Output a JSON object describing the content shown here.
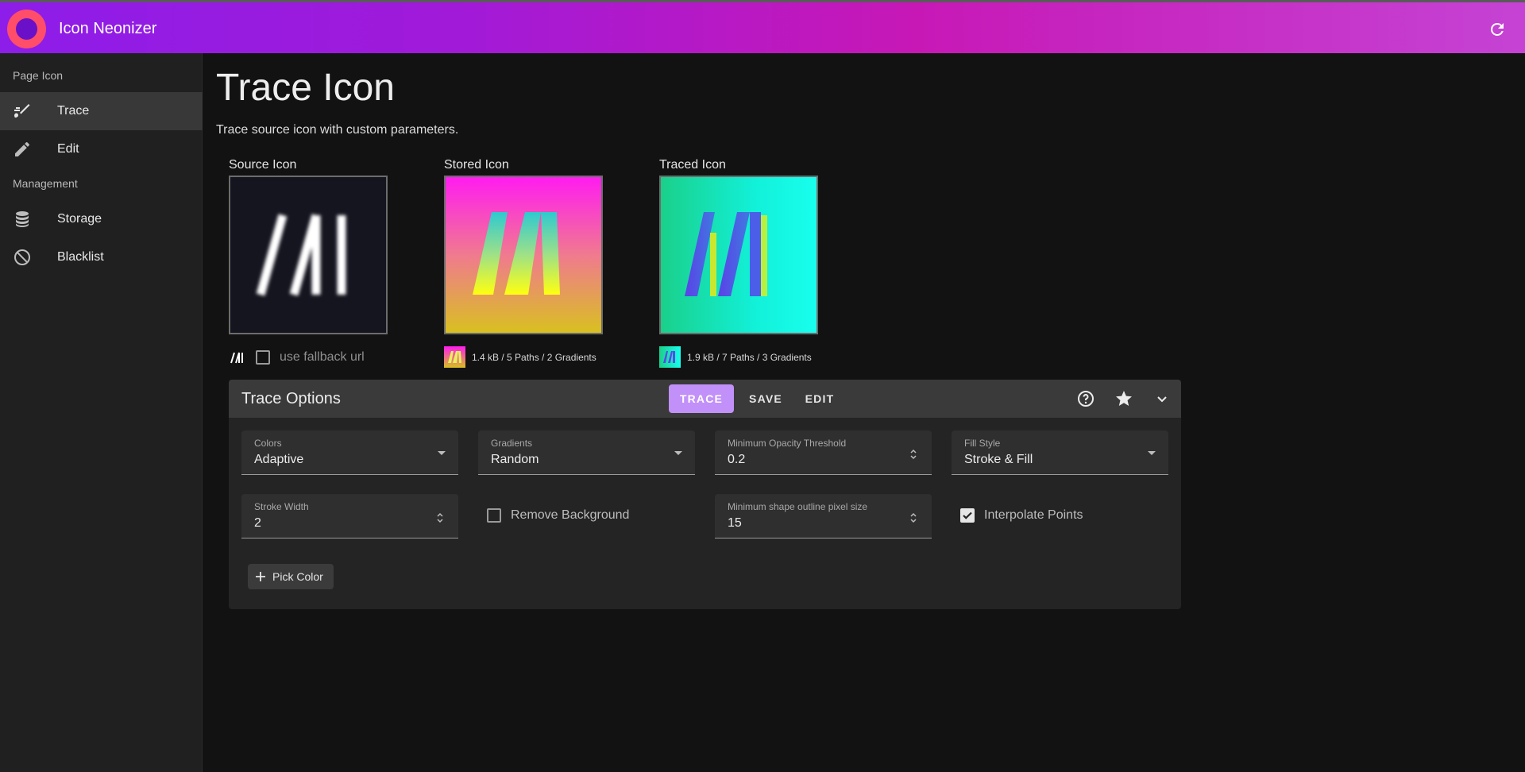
{
  "app": {
    "title": "Icon Neonizer"
  },
  "sidebar": {
    "sections": [
      {
        "header": "Page Icon",
        "items": [
          {
            "label": "Trace",
            "icon": "brush-icon",
            "active": true
          },
          {
            "label": "Edit",
            "icon": "pencil-icon",
            "active": false
          }
        ]
      },
      {
        "header": "Management",
        "items": [
          {
            "label": "Storage",
            "icon": "database-icon",
            "active": false
          },
          {
            "label": "Blacklist",
            "icon": "block-icon",
            "active": false
          }
        ]
      }
    ]
  },
  "page": {
    "title": "Trace Icon",
    "subtitle": "Trace source icon with custom parameters."
  },
  "icons": {
    "source": {
      "label": "Source Icon",
      "fallback_label": "use fallback url",
      "fallback_checked": false
    },
    "stored": {
      "label": "Stored Icon",
      "meta": "1.4 kB / 5 Paths / 2 Gradients"
    },
    "traced": {
      "label": "Traced Icon",
      "meta": "1.9 kB / 7 Paths / 3 Gradients"
    }
  },
  "trace_options": {
    "title": "Trace Options",
    "buttons": {
      "trace": "TRACE",
      "save": "SAVE",
      "edit": "EDIT"
    },
    "fields": {
      "colors": {
        "label": "Colors",
        "value": "Adaptive"
      },
      "gradients": {
        "label": "Gradients",
        "value": "Random"
      },
      "min_opacity": {
        "label": "Minimum Opacity Threshold",
        "value": "0.2"
      },
      "fill_style": {
        "label": "Fill Style",
        "value": "Stroke & Fill"
      },
      "stroke_width": {
        "label": "Stroke Width",
        "value": "2"
      },
      "min_outline": {
        "label": "Minimum shape outline pixel size",
        "value": "15"
      }
    },
    "checkboxes": {
      "remove_background": {
        "label": "Remove Background",
        "checked": false
      },
      "interpolate_points": {
        "label": "Interpolate Points",
        "checked": true
      }
    },
    "pick_color": "Pick Color"
  },
  "colors": {
    "accent": "#c190f9",
    "appbar_start": "#8d1de9",
    "appbar_end": "#c543d4",
    "background": "#121212",
    "sidebar": "#202020"
  }
}
